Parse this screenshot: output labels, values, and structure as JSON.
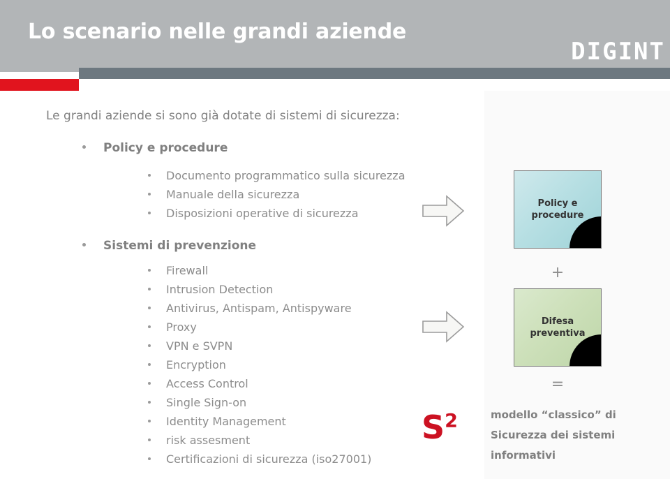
{
  "header": {
    "title": "Lo scenario nelle grandi aziende",
    "logo": "DIGINT",
    "bg_color": "#b2b5b7",
    "accent_bar_color": "#6d7880",
    "red_bar_color": "#e1141e"
  },
  "body": {
    "intro": "Le grandi aziende si sono già dotate di sistemi di sicurezza:",
    "groups": [
      {
        "heading": "Policy e procedure",
        "items": [
          "Documento programmatico sulla sicurezza",
          "Manuale della sicurezza",
          "Disposizioni operative di sicurezza"
        ]
      },
      {
        "heading": "Sistemi di prevenzione",
        "items": [
          "Firewall",
          "Intrusion Detection",
          "Antivirus, Antispam, Antispyware",
          "Proxy",
          "VPN e SVPN",
          "Encryption",
          "Access Control",
          "Single Sign-on",
          "Identity Management",
          "risk assesment",
          "Certificazioni di sicurezza (iso27001)"
        ]
      }
    ]
  },
  "diagram": {
    "boxes": [
      {
        "label_line1": "Policy e",
        "label_line2": "procedure",
        "color": "#b7dfe3"
      },
      {
        "label_line1": "Difesa",
        "label_line2": "preventiva",
        "color": "#cde0ba"
      }
    ],
    "operator_plus": "+",
    "operator_equal": "=",
    "s2_base": "S",
    "s2_exponent": "2",
    "s2_color": "#cc1122",
    "conclusion_lines": [
      "modello “classico” di",
      "Sicurezza dei sistemi",
      "informativi"
    ]
  }
}
